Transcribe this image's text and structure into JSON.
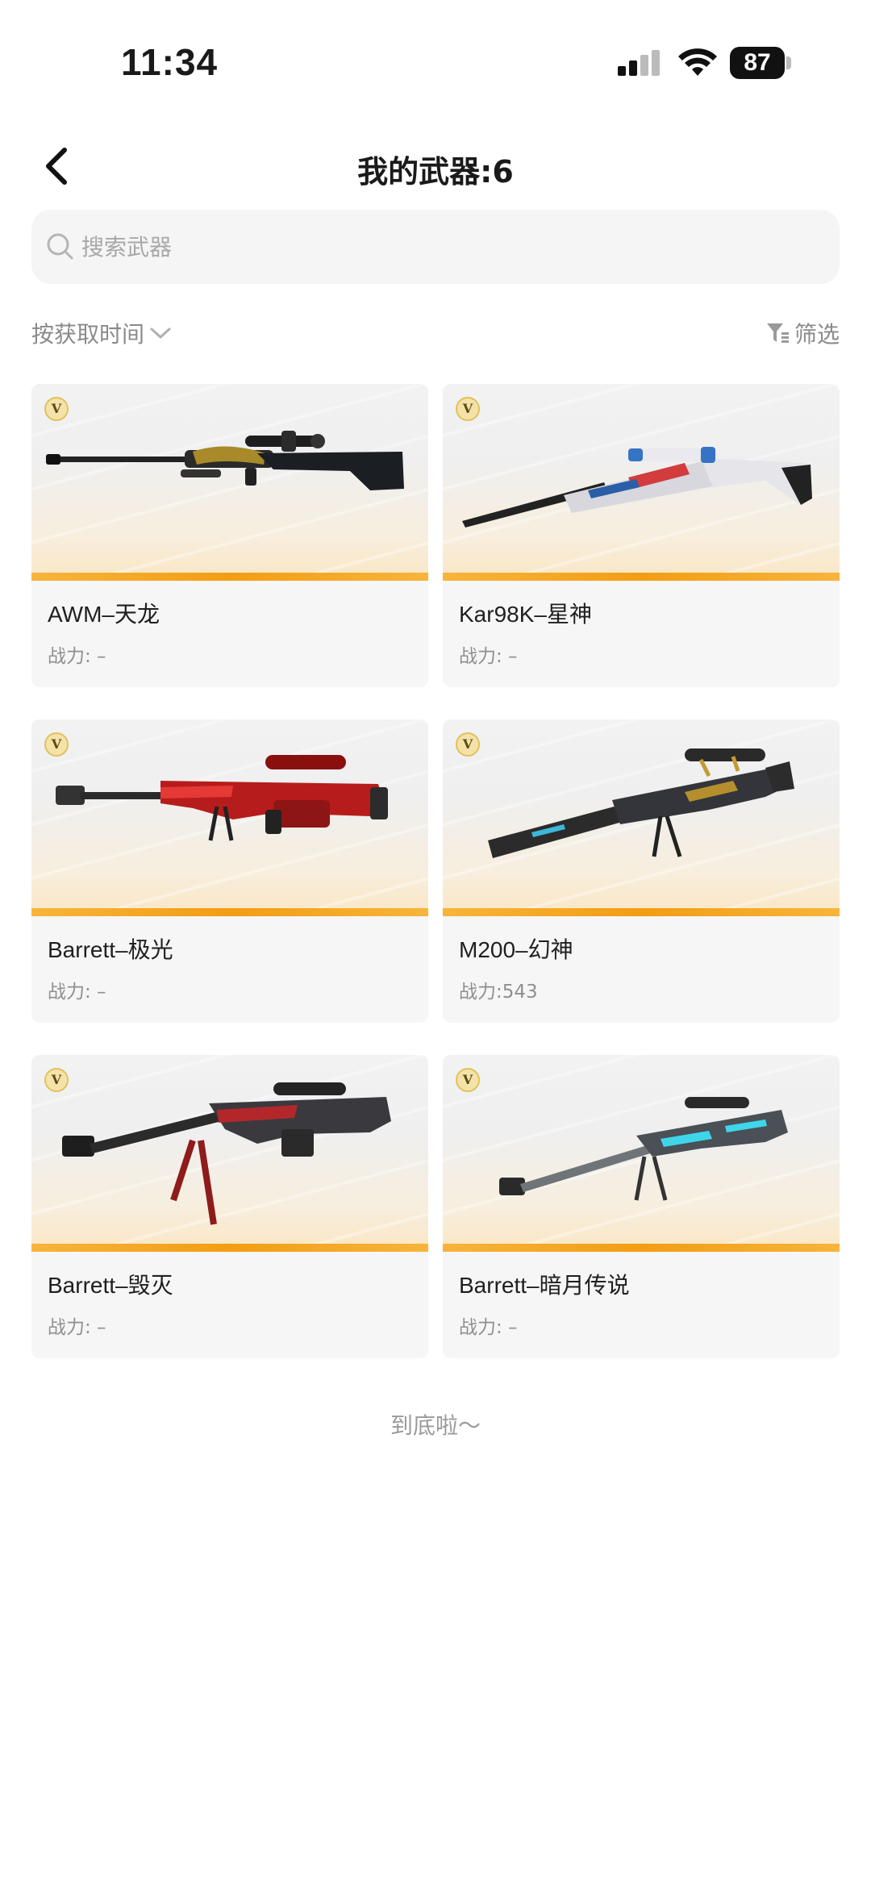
{
  "status_bar": {
    "time": "11:34",
    "battery": "87"
  },
  "header": {
    "title": "我的武器:6"
  },
  "search": {
    "placeholder": "搜索武器"
  },
  "sort": {
    "label": "按获取时间"
  },
  "filter": {
    "label": "筛选"
  },
  "weapons": [
    {
      "name": "AWM–天龙",
      "power": "战力: –",
      "badge": "V"
    },
    {
      "name": "Kar98K–星神",
      "power": "战力: –",
      "badge": "V"
    },
    {
      "name": "Barrett–极光",
      "power": "战力: –",
      "badge": "V"
    },
    {
      "name": "M200–幻神",
      "power": "战力:543",
      "badge": "V"
    },
    {
      "name": "Barrett–毁灭",
      "power": "战力: –",
      "badge": "V"
    },
    {
      "name": "Barrett–暗月传说",
      "power": "战力: –",
      "badge": "V"
    }
  ],
  "footer": {
    "text": "到底啦～"
  },
  "colors": {
    "accent_stripe": "#f39d14",
    "card_bg": "#f6f6f6",
    "muted_text": "#8f8f8f"
  }
}
